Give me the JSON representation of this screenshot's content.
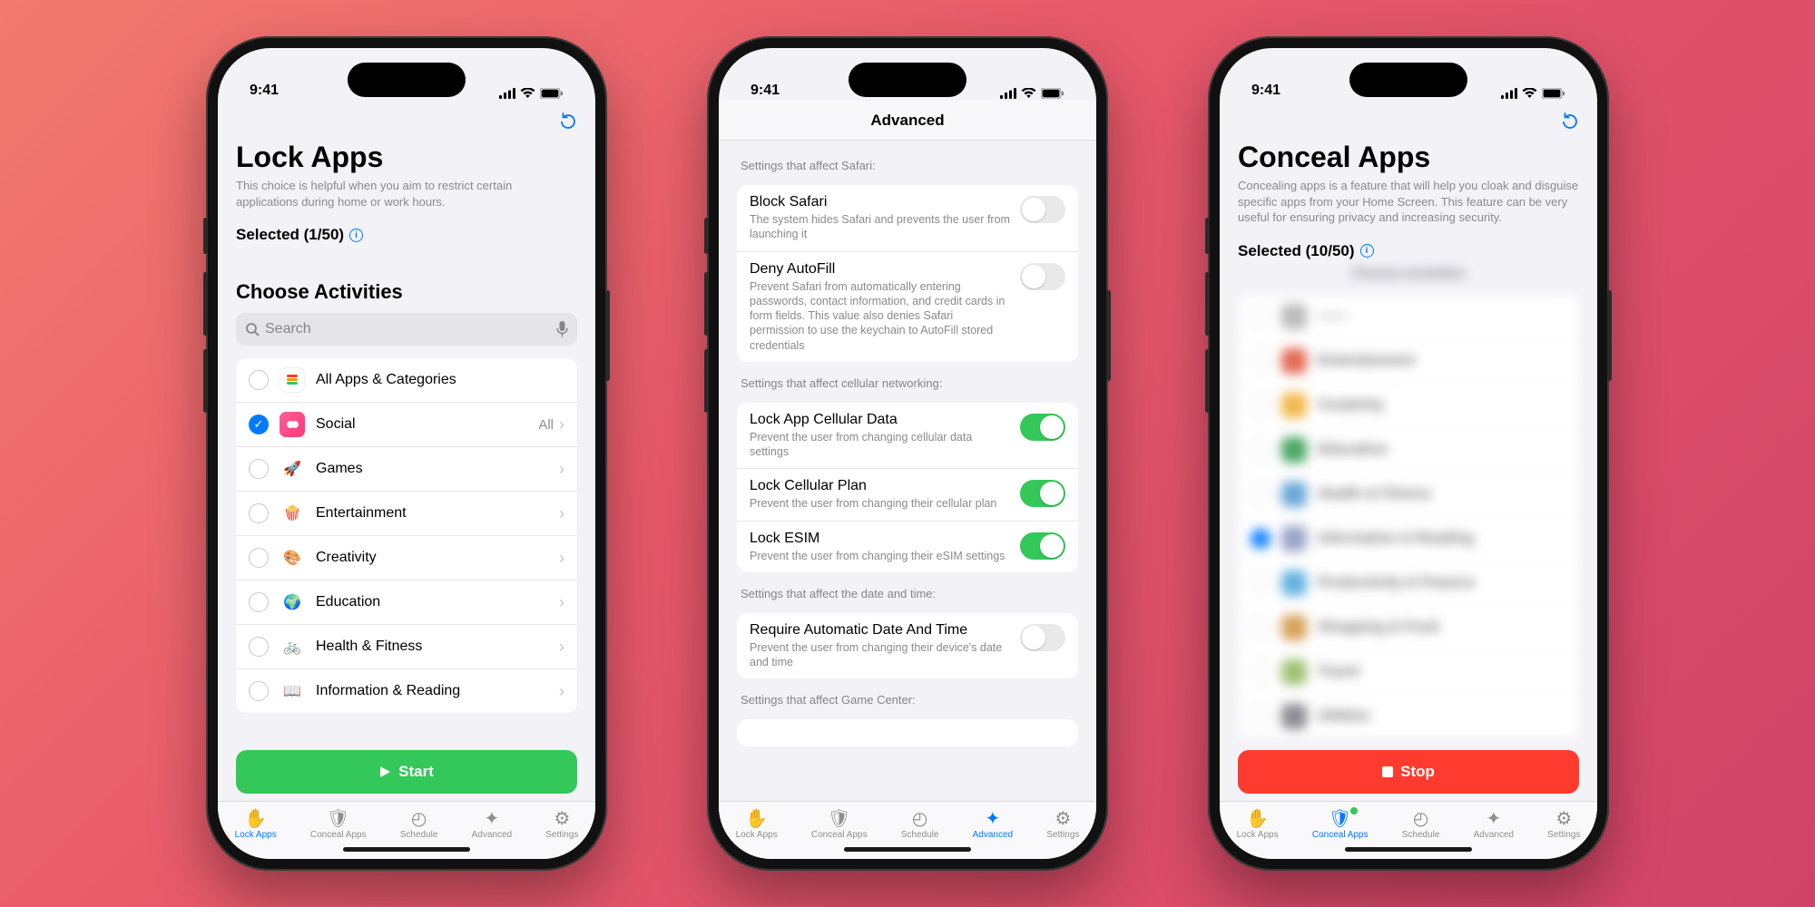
{
  "status": {
    "time": "9:41"
  },
  "tabs": {
    "lock": "Lock Apps",
    "conceal": "Conceal Apps",
    "schedule": "Schedule",
    "advanced": "Advanced",
    "settings": "Settings"
  },
  "screen1": {
    "title": "Lock Apps",
    "subtitle": "This choice is helpful when you aim to restrict certain applications during home or work hours.",
    "selected": "Selected (1/50)",
    "choose": "Choose Activities",
    "search_placeholder": "Search",
    "rows": [
      {
        "label": "All Apps & Categories",
        "checked": false,
        "trail": ""
      },
      {
        "label": "Social",
        "checked": true,
        "trail": "All"
      },
      {
        "label": "Games",
        "checked": false,
        "trail": ""
      },
      {
        "label": "Entertainment",
        "checked": false,
        "trail": ""
      },
      {
        "label": "Creativity",
        "checked": false,
        "trail": ""
      },
      {
        "label": "Education",
        "checked": false,
        "trail": ""
      },
      {
        "label": "Health & Fitness",
        "checked": false,
        "trail": ""
      },
      {
        "label": "Information & Reading",
        "checked": false,
        "trail": ""
      }
    ],
    "start": "Start"
  },
  "screen2": {
    "title": "Advanced",
    "groups": [
      {
        "header": "Settings that affect Safari:",
        "items": [
          {
            "title": "Block Safari",
            "desc": "The system hides Safari and prevents the user from launching it",
            "on": false
          },
          {
            "title": "Deny AutoFill",
            "desc": "Prevent Safari from automatically entering passwords, contact information, and credit cards in form fields. This value also denies Safari permission to use the keychain to AutoFill stored credentials",
            "on": false
          }
        ]
      },
      {
        "header": "Settings that affect cellular networking:",
        "items": [
          {
            "title": "Lock App Cellular Data",
            "desc": "Prevent the user from changing cellular data settings",
            "on": true
          },
          {
            "title": "Lock Cellular Plan",
            "desc": "Prevent the user from changing their cellular plan",
            "on": true
          },
          {
            "title": "Lock ESIM",
            "desc": "Prevent the user from changing their eSIM settings",
            "on": true
          }
        ]
      },
      {
        "header": "Settings that affect the date and time:",
        "items": [
          {
            "title": "Require Automatic Date And Time",
            "desc": "Prevent the user from changing their device's date and time",
            "on": false
          }
        ]
      },
      {
        "header": "Settings that affect Game Center:",
        "items": []
      }
    ]
  },
  "screen3": {
    "title": "Conceal Apps",
    "subtitle": "Concealing apps is a feature that will help you cloak and disguise specific apps from your Home Screen. This feature can be very useful for ensuring privacy and increasing security.",
    "selected": "Selected (10/50)",
    "choose": "Choose Activities",
    "rows": [
      {
        "label": "Entertainment"
      },
      {
        "label": "Creativity"
      },
      {
        "label": "Education"
      },
      {
        "label": "Health & Fitness"
      },
      {
        "label": "Information & Reading"
      },
      {
        "label": "Productivity & Finance"
      },
      {
        "label": "Shopping & Food"
      },
      {
        "label": "Travel"
      },
      {
        "label": "Utilities"
      }
    ],
    "stop": "Stop"
  }
}
